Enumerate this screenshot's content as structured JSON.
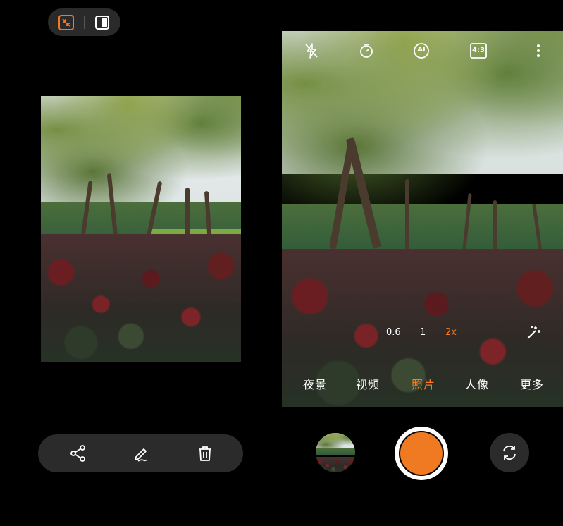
{
  "split_mode": {
    "collapse_icon": "collapse-arrows-icon",
    "layout_icon": "split-layout-icon",
    "accent": "#f07a22"
  },
  "preview_actions": {
    "share_icon": "share-icon",
    "edit_icon": "edit-pencil-icon",
    "delete_icon": "trash-icon"
  },
  "camera": {
    "top_bar": {
      "flash_icon": "flash-off-icon",
      "timer_icon": "timer-icon",
      "ai_label": "AI",
      "aspect_ratio": "4:3",
      "more_icon": "more-vertical-icon"
    },
    "zoom": {
      "levels": [
        "0.6",
        "1",
        "2x"
      ],
      "selected": "2x"
    },
    "magic_icon": "magic-wand-icon",
    "modes": [
      "夜景",
      "视频",
      "照片",
      "人像",
      "更多"
    ],
    "selected_mode": "照片"
  },
  "colors": {
    "accent": "#ff7a1a",
    "shutter": "#f07a22",
    "pill_bg": "#2b2b2b"
  }
}
